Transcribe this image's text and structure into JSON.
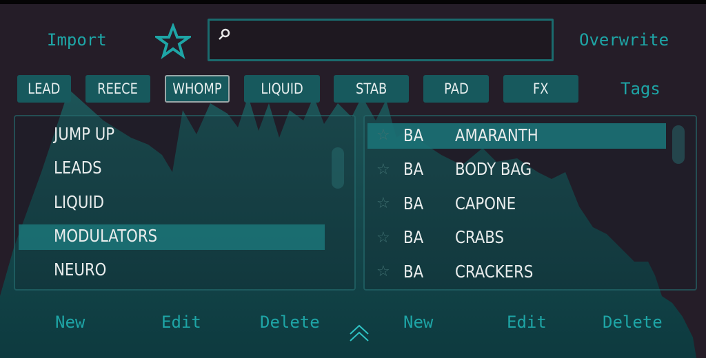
{
  "header": {
    "import_label": "Import",
    "favorites_icon": "star-icon",
    "search": {
      "value": "",
      "icon": "search-icon"
    },
    "overwrite_label": "Overwrite"
  },
  "tags": {
    "items": [
      "LEAD",
      "REECE",
      "WHOMP",
      "LIQUID",
      "STAB",
      "PAD",
      "FX"
    ],
    "active": "WHOMP",
    "label": "Tags"
  },
  "categories": {
    "items": [
      "JUMP UP",
      "LEADS",
      "LIQUID",
      "MODULATORS",
      "NEURO"
    ],
    "selected": "MODULATORS",
    "actions": {
      "new": "New",
      "edit": "Edit",
      "delete": "Delete"
    }
  },
  "presets": {
    "items": [
      {
        "author": "BA",
        "name": "AMARANTH"
      },
      {
        "author": "BA",
        "name": "BODY BAG"
      },
      {
        "author": "BA",
        "name": "CAPONE"
      },
      {
        "author": "BA",
        "name": "CRABS"
      },
      {
        "author": "BA",
        "name": "CRACKERS"
      }
    ],
    "selected": "AMARANTH",
    "actions": {
      "new": "New",
      "edit": "Edit",
      "delete": "Delete"
    }
  },
  "colors": {
    "accent": "#1ea5a6",
    "tag_bg": "#17595d",
    "background": "#251d28"
  }
}
